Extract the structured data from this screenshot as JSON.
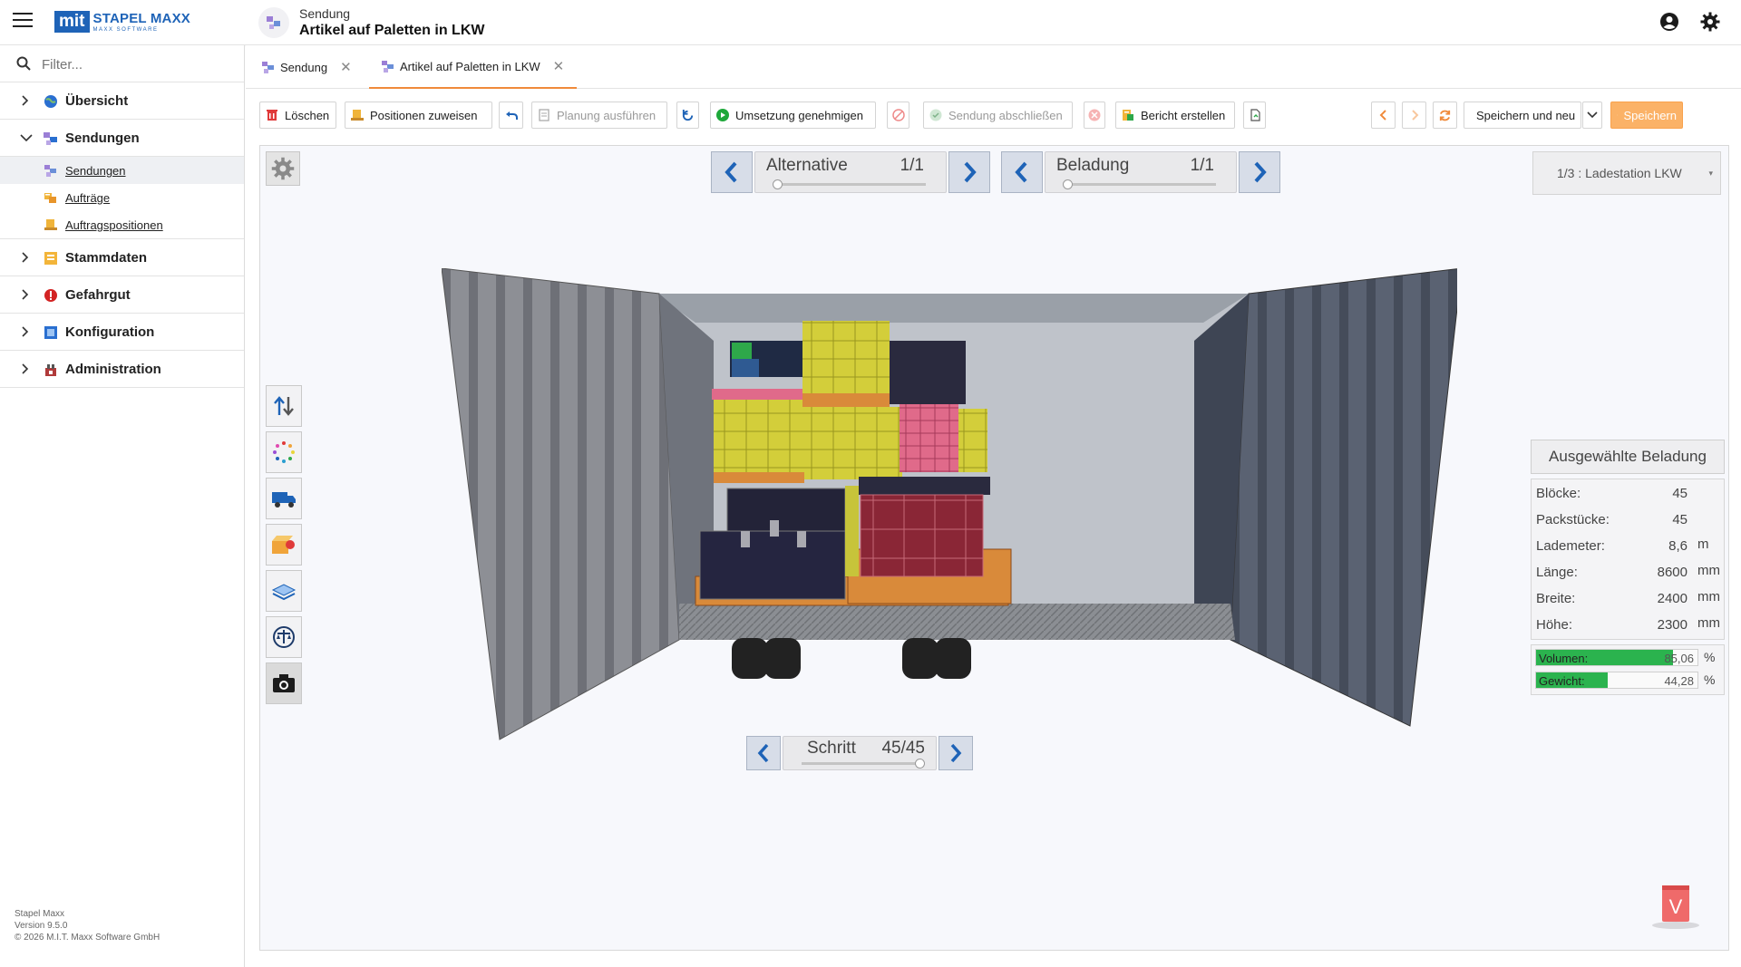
{
  "header": {
    "logo_mark": "mit",
    "logo_name": "STAPEL MAXX",
    "logo_tagline": "MAXX SOFTWARE",
    "subtitle": "Sendung",
    "title": "Artikel auf Paletten in LKW"
  },
  "sidebar": {
    "filter_placeholder": "Filter...",
    "items": [
      {
        "label": "Übersicht",
        "icon": "globe-icon",
        "expanded": false
      },
      {
        "label": "Sendungen",
        "icon": "shipments-icon",
        "expanded": true,
        "children": [
          {
            "label": "Sendungen",
            "icon": "shipments-icon",
            "active": true
          },
          {
            "label": "Aufträge",
            "icon": "orders-icon",
            "active": false
          },
          {
            "label": "Auftragspositionen",
            "icon": "order-items-icon",
            "active": false
          }
        ]
      },
      {
        "label": "Stammdaten",
        "icon": "master-data-icon",
        "expanded": false
      },
      {
        "label": "Gefahrgut",
        "icon": "hazard-icon",
        "expanded": false
      },
      {
        "label": "Konfiguration",
        "icon": "configuration-icon",
        "expanded": false
      },
      {
        "label": "Administration",
        "icon": "administration-icon",
        "expanded": false
      }
    ],
    "footer": {
      "product": "Stapel Maxx",
      "version": "Version 9.5.0",
      "copyright": "© 2026 M.I.T. Maxx Software GmbH"
    }
  },
  "tabs": [
    {
      "label": "Sendung",
      "active": false
    },
    {
      "label": "Artikel auf Paletten in LKW",
      "active": true
    }
  ],
  "toolbar": {
    "delete": "Löschen",
    "assign_positions": "Positionen zuweisen",
    "run_planning": "Planung ausführen",
    "approve_implementation": "Umsetzung genehmigen",
    "complete_shipment": "Sendung abschließen",
    "create_report": "Bericht erstellen",
    "save_and_new": "Speichern und neu",
    "save": "Speichern"
  },
  "viewer": {
    "alternative": {
      "label": "Alternative",
      "value": "1/1",
      "fraction": 0
    },
    "loading": {
      "label": "Beladung",
      "value": "1/1",
      "fraction": 0
    },
    "step": {
      "label": "Schritt",
      "value": "45/45",
      "fraction": 1
    },
    "station": "1/3 : Ladestation LKW",
    "selected_loading": {
      "title": "Ausgewählte Beladung",
      "rows": [
        {
          "label": "Blöcke:",
          "value": "45",
          "unit": ""
        },
        {
          "label": "Packstücke:",
          "value": "45",
          "unit": ""
        },
        {
          "label": "Lademeter:",
          "value": "8,6",
          "unit": "m"
        },
        {
          "label": "Länge:",
          "value": "8600",
          "unit": "mm"
        },
        {
          "label": "Breite:",
          "value": "2400",
          "unit": "mm"
        },
        {
          "label": "Höhe:",
          "value": "2300",
          "unit": "mm"
        }
      ],
      "volume": {
        "label": "Volumen:",
        "value": "85,06",
        "percent": 85.06,
        "unit": "%"
      },
      "weight": {
        "label": "Gewicht:",
        "value": "44,28",
        "percent": 44.28,
        "unit": "%"
      }
    },
    "badge_letter": "V"
  },
  "colors": {
    "accent": "#1e63b7",
    "save_button": "#fbb267",
    "active_tab_underline": "#f08a3a",
    "progress_fill": "#2bb34e"
  }
}
